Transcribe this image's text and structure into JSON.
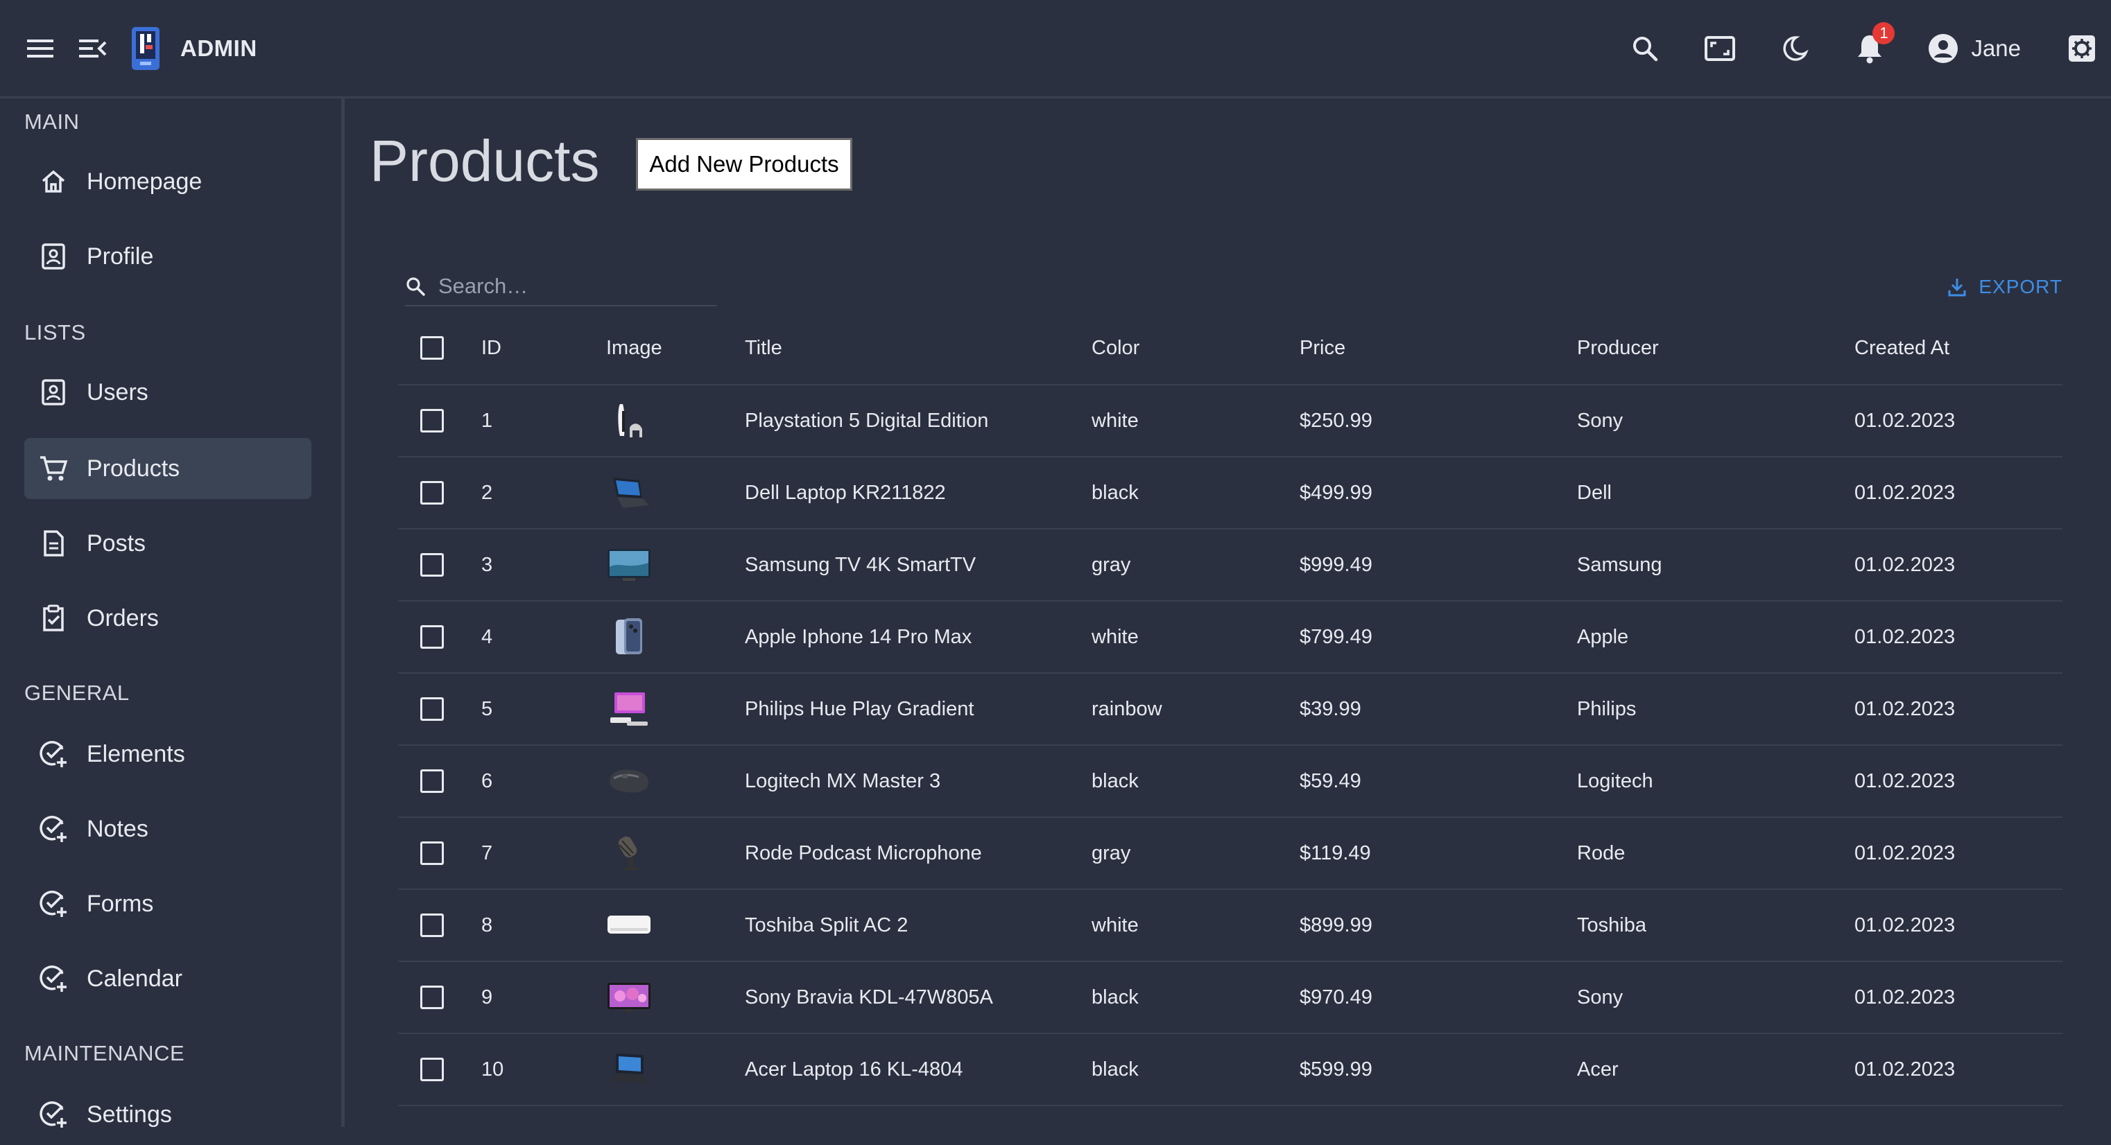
{
  "header": {
    "brand": "ADMIN",
    "user_name": "Jane",
    "notification_count": "1"
  },
  "sidebar": {
    "sections": [
      {
        "title": "MAIN",
        "items": [
          {
            "label": "Homepage",
            "icon": "home-icon"
          },
          {
            "label": "Profile",
            "icon": "profile-icon"
          }
        ]
      },
      {
        "title": "LISTS",
        "items": [
          {
            "label": "Users",
            "icon": "users-icon"
          },
          {
            "label": "Products",
            "icon": "cart-icon"
          },
          {
            "label": "Posts",
            "icon": "document-icon"
          },
          {
            "label": "Orders",
            "icon": "clipboard-check-icon"
          }
        ]
      },
      {
        "title": "GENERAL",
        "items": [
          {
            "label": "Elements",
            "icon": "check-plus-icon"
          },
          {
            "label": "Notes",
            "icon": "check-plus-icon"
          },
          {
            "label": "Forms",
            "icon": "check-plus-icon"
          },
          {
            "label": "Calendar",
            "icon": "check-plus-icon"
          }
        ]
      },
      {
        "title": "MAINTENANCE",
        "items": [
          {
            "label": "Settings",
            "icon": "check-plus-icon"
          }
        ]
      }
    ],
    "active_item": "Products"
  },
  "main": {
    "title": "Products",
    "add_button": "Add New Products",
    "search_placeholder": "Search…",
    "export_label": "EXPORT",
    "columns": [
      "ID",
      "Image",
      "Title",
      "Color",
      "Price",
      "Producer",
      "Created At"
    ],
    "rows": [
      {
        "id": "1",
        "title": "Playstation 5 Digital Edition",
        "color": "white",
        "price": "$250.99",
        "producer": "Sony",
        "created": "01.02.2023",
        "image": "console-icon"
      },
      {
        "id": "2",
        "title": "Dell Laptop KR211822",
        "color": "black",
        "price": "$499.99",
        "producer": "Dell",
        "created": "01.02.2023",
        "image": "laptop-icon"
      },
      {
        "id": "3",
        "title": "Samsung TV 4K SmartTV",
        "color": "gray",
        "price": "$999.49",
        "producer": "Samsung",
        "created": "01.02.2023",
        "image": "tv-icon"
      },
      {
        "id": "4",
        "title": "Apple Iphone 14 Pro Max",
        "color": "white",
        "price": "$799.49",
        "producer": "Apple",
        "created": "01.02.2023",
        "image": "phone-icon"
      },
      {
        "id": "5",
        "title": "Philips Hue Play Gradient",
        "color": "rainbow",
        "price": "$39.99",
        "producer": "Philips",
        "created": "01.02.2023",
        "image": "lightbar-icon"
      },
      {
        "id": "6",
        "title": "Logitech MX Master 3",
        "color": "black",
        "price": "$59.49",
        "producer": "Logitech",
        "created": "01.02.2023",
        "image": "mouse-icon"
      },
      {
        "id": "7",
        "title": "Rode Podcast Microphone",
        "color": "gray",
        "price": "$119.49",
        "producer": "Rode",
        "created": "01.02.2023",
        "image": "microphone-icon"
      },
      {
        "id": "8",
        "title": "Toshiba Split AC 2",
        "color": "white",
        "price": "$899.99",
        "producer": "Toshiba",
        "created": "01.02.2023",
        "image": "air-conditioner-icon"
      },
      {
        "id": "9",
        "title": "Sony Bravia KDL-47W805A",
        "color": "black",
        "price": "$970.49",
        "producer": "Sony",
        "created": "01.02.2023",
        "image": "tv-icon"
      },
      {
        "id": "10",
        "title": "Acer Laptop 16 KL-4804",
        "color": "black",
        "price": "$599.99",
        "producer": "Acer",
        "created": "01.02.2023",
        "image": "laptop-icon"
      }
    ]
  },
  "colors": {
    "background": "#2b3040",
    "active_item": "#3b4454",
    "accent": "#3d8ee6",
    "badge": "#e53935"
  }
}
